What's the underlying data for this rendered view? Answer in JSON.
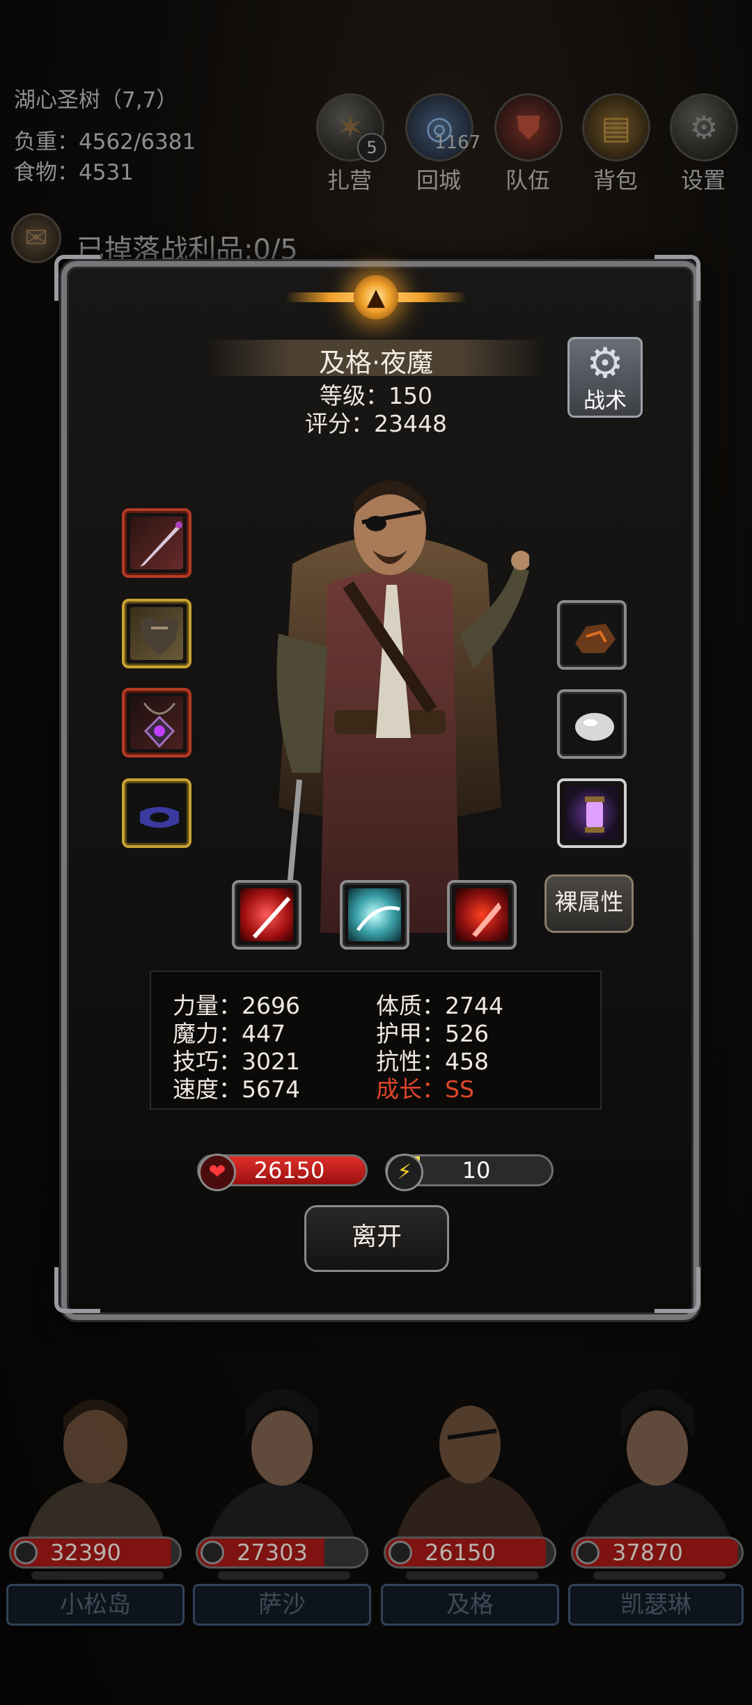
{
  "location": {
    "name": "湖心圣树（7,7）",
    "load": "负重：4562/6381",
    "food": "食物：4531"
  },
  "hud": {
    "camp": {
      "label": "扎营",
      "badge": "5",
      "icon": "camp-fire-icon"
    },
    "return": {
      "label": "回城",
      "count": "1167",
      "icon": "portal-icon"
    },
    "team": {
      "label": "队伍",
      "icon": "team-shield-icon"
    },
    "bag": {
      "label": "背包",
      "icon": "barrel-icon"
    },
    "settings": {
      "label": "设置",
      "icon": "gear-icon"
    }
  },
  "loot": {
    "text": "已掉落战利品:0/5",
    "icon": "scroll-icon"
  },
  "character": {
    "name": "及格·夜魔",
    "level": "等级：150",
    "score": "评分：23448",
    "tactics_label": "战术",
    "naked_attr_label": "裸属性",
    "equipment_left": [
      "sword-icon",
      "armor-icon",
      "amulet-icon",
      "ring-icon"
    ],
    "equipment_right": [
      "ore-icon",
      "stone-icon",
      "lantern-icon"
    ],
    "skills": [
      "slash-skill-icon",
      "wind-blade-skill-icon",
      "blood-strike-skill-icon"
    ],
    "stats": {
      "strength": "力量：2696",
      "magic": "魔力：447",
      "skill": "技巧：3021",
      "speed": "速度：5674",
      "constitution": "体质：2744",
      "armor": "护甲：526",
      "resistance": "抗性：458",
      "growth": "成长：SS"
    },
    "hp": {
      "value": "26150",
      "fill": 1.0
    },
    "energy": {
      "value": "10",
      "fill": 0.2
    },
    "leave_label": "离开"
  },
  "party": [
    {
      "hp": "32390",
      "name": "小松岛",
      "fill": 0.95
    },
    {
      "hp": "27303",
      "name": "萨沙",
      "fill": 0.75
    },
    {
      "hp": "26150",
      "name": "及格",
      "fill": 0.95
    },
    {
      "hp": "37870",
      "name": "凯瑟琳",
      "fill": 0.98
    }
  ],
  "colors": {
    "growth": "#e0462a",
    "hp": "#c81a14",
    "energy": "#f2d21e",
    "panel_border": "#77777a"
  }
}
